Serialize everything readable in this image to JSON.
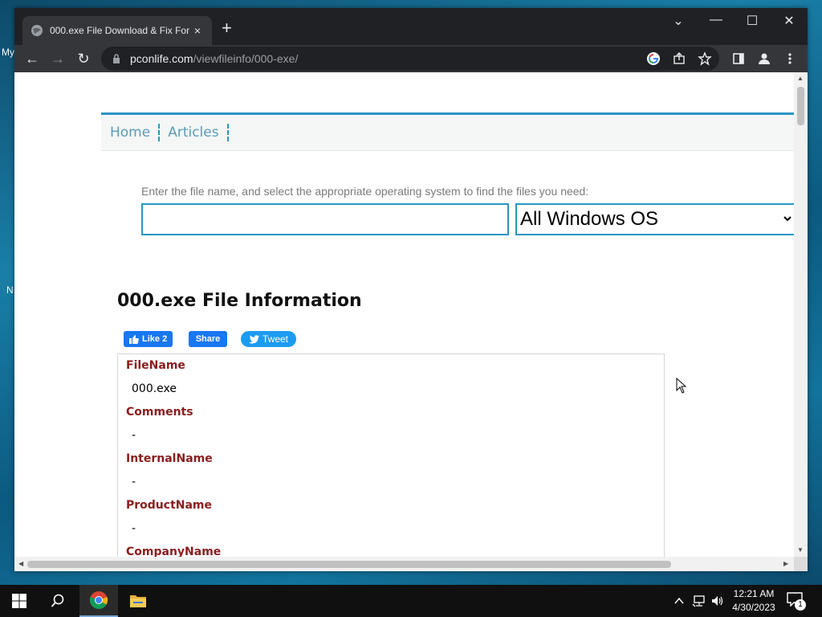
{
  "desktop": {
    "fragments": [
      "My",
      "N"
    ]
  },
  "browser": {
    "tab": {
      "title": "000.exe File Download & Fix For",
      "close": "×"
    },
    "new_tab": "+",
    "window_controls": {
      "tabsearch": "⌄",
      "minimize": "—",
      "maximize": "☐",
      "close": "✕"
    },
    "nav": {
      "back": "←",
      "forward": "→",
      "reload": "↻"
    },
    "url": {
      "host": "pconlife.com",
      "path": "/viewfileinfo/000-exe/"
    },
    "toolbar_icons": [
      "google-lens-icon",
      "share-icon",
      "star-icon",
      "side-panel-icon",
      "profile-icon",
      "menu-icon"
    ]
  },
  "page": {
    "nav": [
      "Home",
      "Articles"
    ],
    "search_hint": "Enter the file name, and select the appropriate operating system to find the files you need:",
    "search_value": "",
    "os_select": "All Windows OS",
    "title": "000.exe File Information",
    "social": {
      "like": "Like 2",
      "share": "Share",
      "tweet": "Tweet"
    },
    "fields": [
      {
        "label": "FileName",
        "value": "000.exe"
      },
      {
        "label": "Comments",
        "value": "-"
      },
      {
        "label": "InternalName",
        "value": "-"
      },
      {
        "label": "ProductName",
        "value": "-"
      },
      {
        "label": "CompanyName",
        "value": ""
      }
    ]
  },
  "taskbar": {
    "time": "12:21 AM",
    "date": "4/30/2023",
    "notification_count": "1"
  }
}
